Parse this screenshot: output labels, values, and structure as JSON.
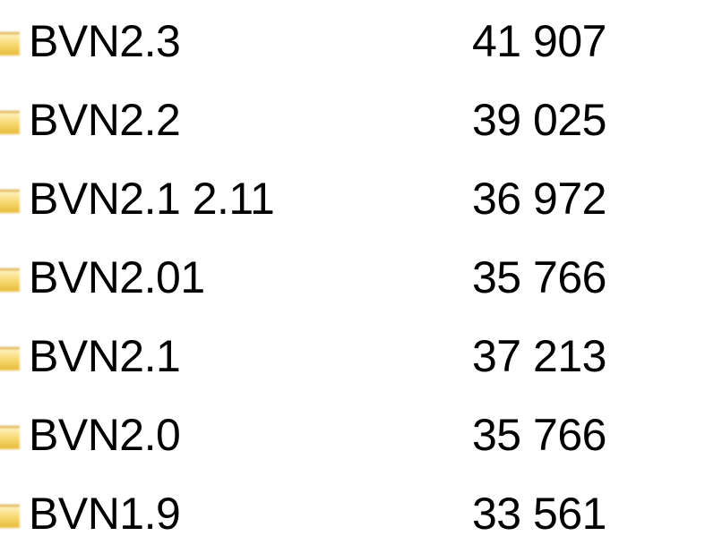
{
  "files": [
    {
      "name": "BVN2.3",
      "size": "41 907"
    },
    {
      "name": "BVN2.2",
      "size": "39 025"
    },
    {
      "name": "BVN2.1 2.11",
      "size": "36 972"
    },
    {
      "name": "BVN2.01",
      "size": "35 766"
    },
    {
      "name": "BVN2.1",
      "size": "37 213"
    },
    {
      "name": "BVN2.0",
      "size": "35 766"
    },
    {
      "name": "BVN1.9",
      "size": "33 561"
    }
  ]
}
